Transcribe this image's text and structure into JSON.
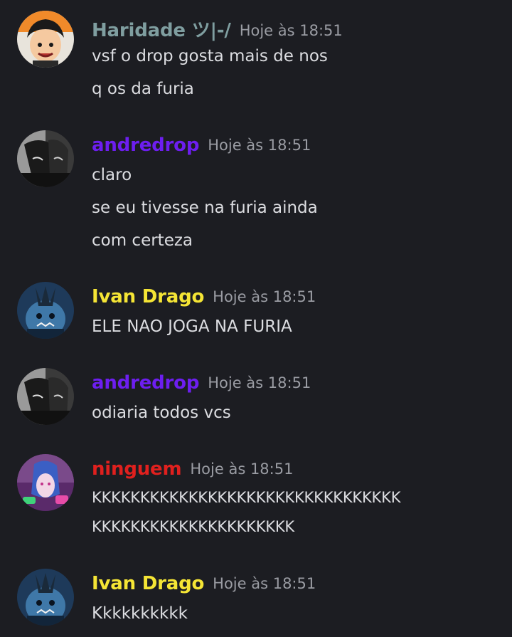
{
  "colors": {
    "background": "#1c1d22",
    "haridade": "#7f9ea0",
    "andredrop": "#6d1ef0",
    "ivan": "#f5e535",
    "ninguem": "#e0201e",
    "timestamp": "#9a9ca3",
    "message": "#dcdde1"
  },
  "messages": [
    {
      "author": "Haridade ツ|-/",
      "time": "Hoje às 18:51",
      "avatar_icon": "luffy-avatar-icon",
      "lines": [
        "vsf o drop gosta mais de nos",
        "q os da furia"
      ]
    },
    {
      "author": "andredrop",
      "time": "Hoje às 18:51",
      "avatar_icon": "manga-avatar-icon",
      "lines": [
        "claro",
        "se eu tivesse na furia ainda",
        "com certeza"
      ]
    },
    {
      "author": "Ivan Drago",
      "time": "Hoje às 18:51",
      "avatar_icon": "jinbe-avatar-icon",
      "lines": [
        "ELE NAO JOGA NA FURIA"
      ]
    },
    {
      "author": "andredrop",
      "time": "Hoje às 18:51",
      "avatar_icon": "manga-avatar-icon",
      "lines": [
        "odiaria todos vcs"
      ]
    },
    {
      "author": "ninguem",
      "time": "Hoje às 18:51",
      "avatar_icon": "jinx-avatar-icon",
      "lines": [
        "KKKKKKKKKKKKKKKKKKKKKKKKKKKKKKKK",
        "KKKKKKKKKKKKKKKKKKKKK"
      ]
    },
    {
      "author": "Ivan Drago",
      "time": "Hoje às 18:51",
      "avatar_icon": "jinbe-avatar-icon",
      "lines": [
        "Kkkkkkkkkk"
      ]
    }
  ]
}
